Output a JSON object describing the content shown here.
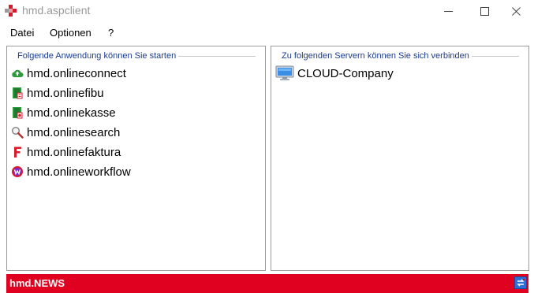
{
  "window": {
    "title": "hmd.aspclient",
    "controls": {
      "minimize": "minimize-icon",
      "maximize": "maximize-icon",
      "close": "close-icon"
    }
  },
  "menu": {
    "items": [
      "Datei",
      "Optionen",
      "?"
    ]
  },
  "apps_panel": {
    "legend": "Folgende Anwendung können Sie starten",
    "items": [
      {
        "label": "hmd.onlineconnect",
        "icon": "cloud-upload-icon",
        "color": "#2e9a3e"
      },
      {
        "label": "hmd.onlinefibu",
        "icon": "fibu-book-icon",
        "color": "#2e9a3e"
      },
      {
        "label": "hmd.onlinekasse",
        "icon": "kasse-book-icon",
        "color": "#2e9a3e"
      },
      {
        "label": "hmd.onlinesearch",
        "icon": "magnifier-icon",
        "color": "#b03030"
      },
      {
        "label": "hmd.onlinefaktura",
        "icon": "faktura-f-icon",
        "color": "#d81b2c"
      },
      {
        "label": "hmd.onlineworkflow",
        "icon": "workflow-icon",
        "color": "#7a2ad0"
      }
    ]
  },
  "servers_panel": {
    "legend": "Zu folgenden Servern können Sie sich verbinden",
    "items": [
      {
        "label": "CLOUD-Company",
        "icon": "monitor-icon"
      }
    ]
  },
  "news": {
    "title": "hmd.NEWS",
    "refresh_icon": "refresh-icon",
    "color": "#e0001f"
  }
}
